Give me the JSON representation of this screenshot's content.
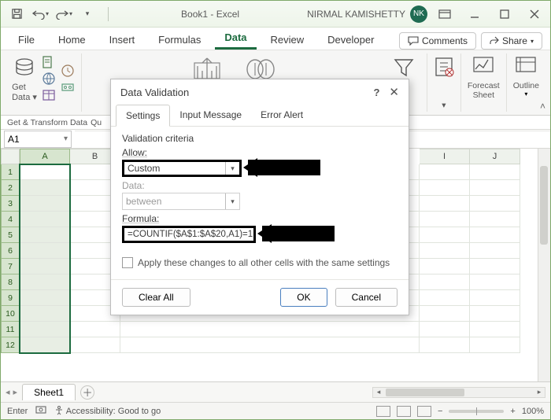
{
  "titlebar": {
    "doc_title": "Book1 - Excel",
    "user": "NIRMAL KAMISHETTY",
    "user_initials": "NK"
  },
  "ribbon": {
    "tabs": [
      "File",
      "Home",
      "Insert",
      "Formulas",
      "Data",
      "Review",
      "Developer"
    ],
    "active_tab": "Data",
    "comments": "Comments",
    "share": "Share",
    "groups": {
      "get_data": "Get Data",
      "forecast": "Forecast Sheet",
      "outline": "Outline",
      "get_transform_label": "Get & Transform Data",
      "queries_label_short": "Qu"
    }
  },
  "namebox": {
    "value": "A1"
  },
  "columns": [
    "A",
    "B",
    "I",
    "J"
  ],
  "rows": [
    "1",
    "2",
    "3",
    "4",
    "5",
    "6",
    "7",
    "8",
    "9",
    "10",
    "11",
    "12"
  ],
  "sheettabs": {
    "active": "Sheet1"
  },
  "statusbar": {
    "mode": "Enter",
    "accessibility": "Accessibility: Good to go",
    "zoom": "100%"
  },
  "dialog": {
    "title": "Data Validation",
    "tabs": [
      "Settings",
      "Input Message",
      "Error Alert"
    ],
    "active_tab": "Settings",
    "criteria_header": "Validation criteria",
    "allow_label": "Allow:",
    "allow_value": "Custom",
    "data_label": "Data:",
    "data_value": "between",
    "formula_label": "Formula:",
    "formula_value": "=COUNTIF($A$1:$A$20,A1)=1",
    "apply_label": "Apply these changes to all other cells with the same settings",
    "clear_all": "Clear All",
    "ok": "OK",
    "cancel": "Cancel"
  }
}
